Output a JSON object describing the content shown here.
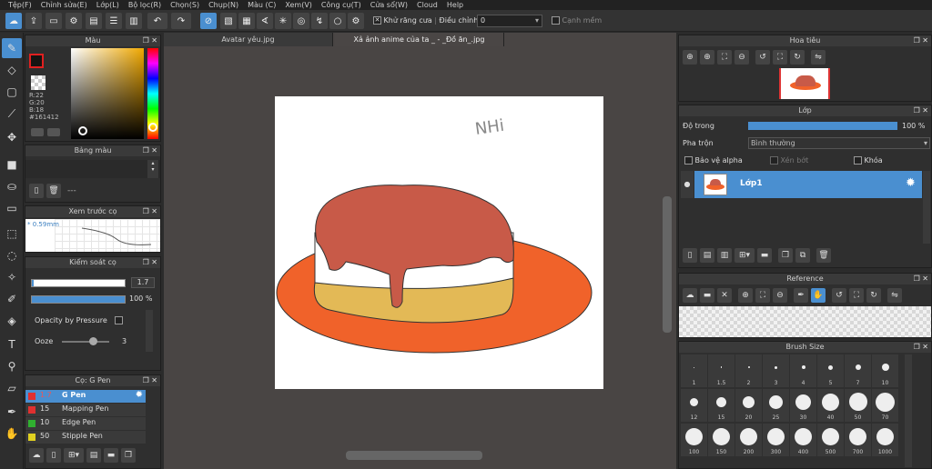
{
  "menu": [
    "Tệp(F)",
    "Chỉnh sửa(E)",
    "Lớp(L)",
    "Bộ lọc(R)",
    "Chọn(S)",
    "Chụp(N)",
    "Màu (C)",
    "Xem(V)",
    "Công cụ(T)",
    "Cửa sổ(W)",
    "Cloud",
    "Help"
  ],
  "toolbar": {
    "antialias_label": "Khử răng cưa",
    "adjust_label": "Điều chỉnh",
    "adjust_value": "0",
    "smooth_label": "Cạnh mềm"
  },
  "color_panel": {
    "title": "Màu",
    "r": "R:22",
    "g": "G:20",
    "b": "B:18",
    "hex": "#161412",
    "fg_color": "#161412"
  },
  "palette_panel": {
    "title": "Bảng màu",
    "dashes": "---"
  },
  "brush_preview": {
    "title": "Xem trước cọ",
    "size": "0.59mm"
  },
  "brush_control": {
    "title": "Kiểm soát cọ",
    "size_value": "1.7",
    "opacity_value": "100 %",
    "opacity_pressure_label": "Opacity by Pressure",
    "ooze_label": "Ooze",
    "ooze_value": "3"
  },
  "brush_list": {
    "title": "Cọ: G Pen",
    "items": [
      {
        "size": "1.7",
        "name": "G Pen",
        "color": "#e03030",
        "active": true
      },
      {
        "size": "15",
        "name": "Mapping Pen",
        "color": "#e03030"
      },
      {
        "size": "10",
        "name": "Edge Pen",
        "color": "#30b030"
      },
      {
        "size": "50",
        "name": "Stipple Pen",
        "color": "#e0d020"
      }
    ]
  },
  "tabs": [
    "Avatar yêu.jpg",
    "Xả ảnh anime của ta _ - _Đồ ăn_.jpg"
  ],
  "artwork": {
    "signature": "NHi",
    "plate_color": "#f0622a",
    "band_color": "#e3b956",
    "cake_color": "#ffffff",
    "sauce_color": "#c85a48"
  },
  "navigator": {
    "title": "Hoa tiêu"
  },
  "layer_panel": {
    "title": "Lớp",
    "opacity_label": "Độ trong",
    "opacity_value": "100 %",
    "blend_label": "Pha trộn",
    "blend_value": "Bình thường",
    "protect_alpha": "Bảo vệ alpha",
    "clipping": "Xén bớt",
    "lock": "Khóa",
    "layer_name": "Lớp1"
  },
  "reference": {
    "title": "Reference"
  },
  "brush_size": {
    "title": "Brush Size",
    "sizes": [
      "1",
      "1.5",
      "2",
      "3",
      "4",
      "5",
      "7",
      "10",
      "12",
      "15",
      "20",
      "25",
      "30",
      "40",
      "50",
      "70",
      "100",
      "150",
      "200",
      "300",
      "400",
      "500",
      "700",
      "1000"
    ]
  },
  "accent": "#4a8fd0"
}
